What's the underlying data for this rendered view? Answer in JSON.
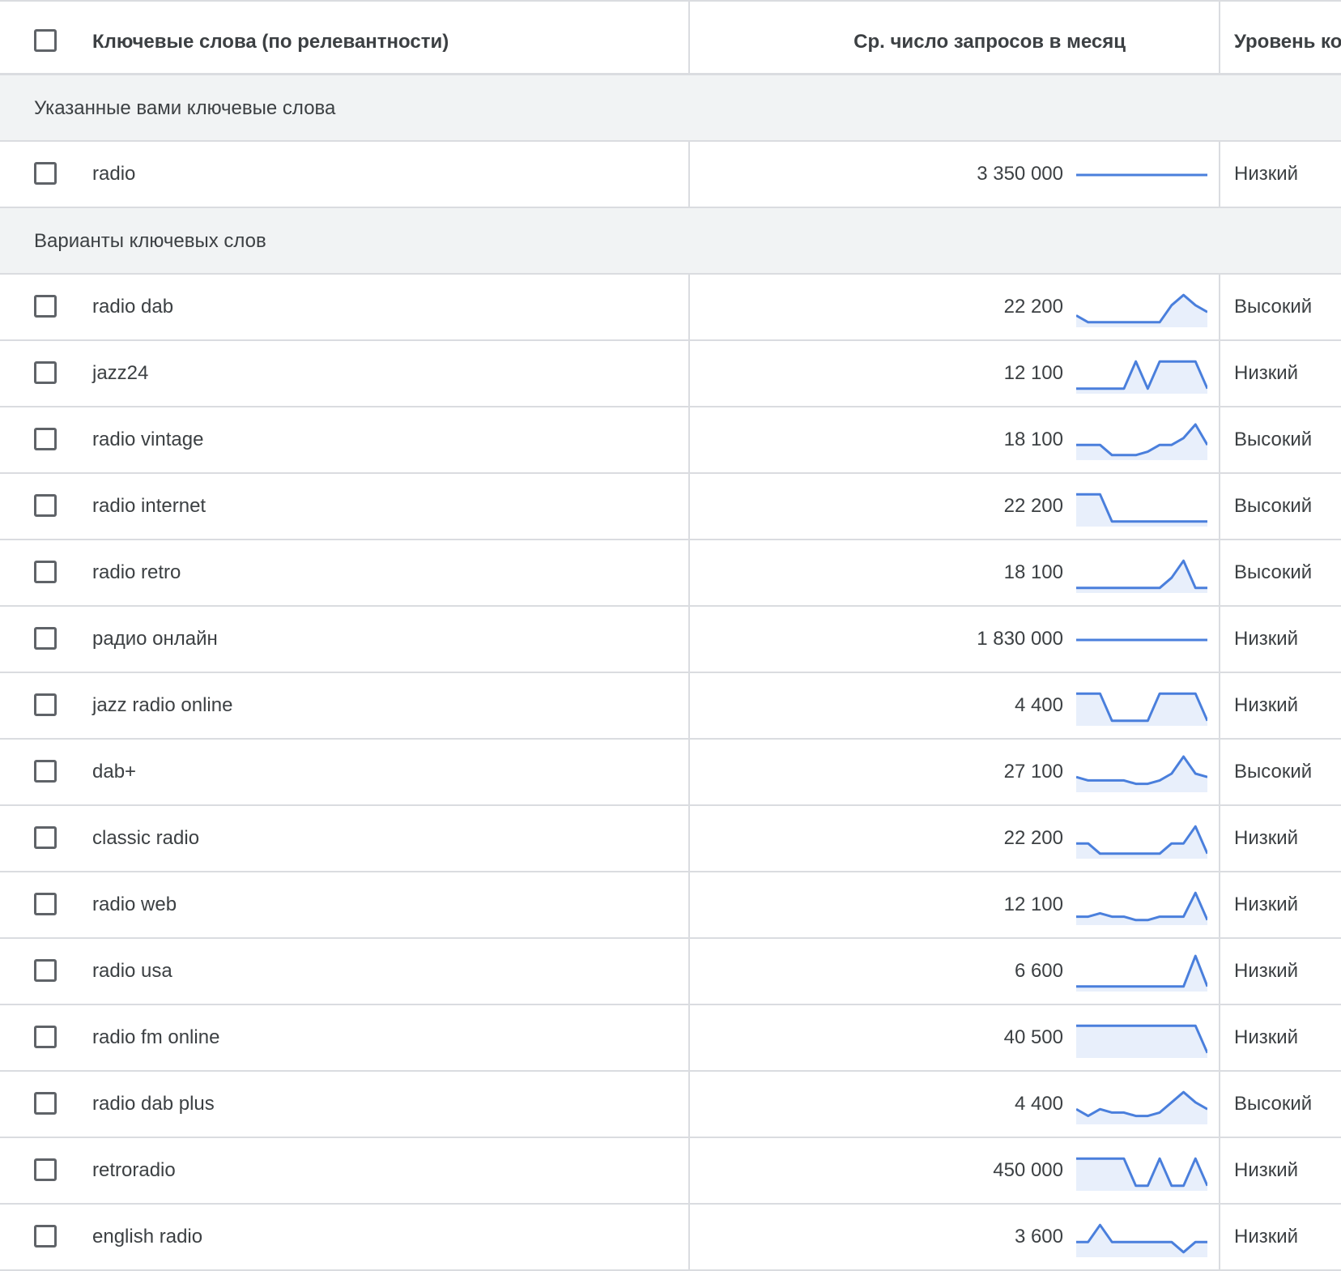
{
  "header": {
    "keywords_label": "Ключевые слова (по релевантности)",
    "volume_label": "Ср. число запросов в месяц",
    "competition_label": "Уровень конкуренции"
  },
  "groups": [
    {
      "label": "Указанные вами ключевые слова",
      "rows": [
        {
          "keyword": "radio",
          "volume": "3 350 000",
          "competition": "Низкий",
          "trend": [
            5,
            5,
            5,
            5,
            5,
            5,
            5,
            5,
            5,
            5,
            5,
            5
          ]
        }
      ]
    },
    {
      "label": "Варианты ключевых слов",
      "rows": [
        {
          "keyword": "radio dab",
          "volume": "22 200",
          "competition": "Высокий",
          "trend": [
            3,
            1,
            1,
            1,
            1,
            1,
            1,
            1,
            6,
            9,
            6,
            4
          ]
        },
        {
          "keyword": "jazz24",
          "volume": "12 100",
          "competition": "Низкий",
          "trend": [
            1,
            1,
            1,
            1,
            1,
            9,
            1,
            9,
            9,
            9,
            9,
            1
          ]
        },
        {
          "keyword": "radio vintage",
          "volume": "18 100",
          "competition": "Высокий",
          "trend": [
            4,
            4,
            4,
            1,
            1,
            1,
            2,
            4,
            4,
            6,
            10,
            4
          ]
        },
        {
          "keyword": "radio internet",
          "volume": "22 200",
          "competition": "Высокий",
          "trend": [
            9,
            9,
            9,
            1,
            1,
            1,
            1,
            1,
            1,
            1,
            1,
            1
          ]
        },
        {
          "keyword": "radio retro",
          "volume": "18 100",
          "competition": "Высокий",
          "trend": [
            1,
            1,
            1,
            1,
            1,
            1,
            1,
            1,
            4,
            9,
            1,
            1
          ]
        },
        {
          "keyword": "радио онлайн",
          "volume": "1 830 000",
          "competition": "Низкий",
          "trend": [
            5,
            5,
            5,
            5,
            5,
            5,
            5,
            5,
            5,
            5,
            5,
            5
          ]
        },
        {
          "keyword": "jazz radio online",
          "volume": "4 400",
          "competition": "Низкий",
          "trend": [
            9,
            9,
            9,
            1,
            1,
            1,
            1,
            9,
            9,
            9,
            9,
            1
          ]
        },
        {
          "keyword": "dab+",
          "volume": "27 100",
          "competition": "Высокий",
          "trend": [
            4,
            3,
            3,
            3,
            3,
            2,
            2,
            3,
            5,
            10,
            5,
            4
          ]
        },
        {
          "keyword": "classic radio",
          "volume": "22 200",
          "competition": "Низкий",
          "trend": [
            4,
            4,
            1,
            1,
            1,
            1,
            1,
            1,
            4,
            4,
            9,
            1
          ]
        },
        {
          "keyword": "radio web",
          "volume": "12 100",
          "competition": "Низкий",
          "trend": [
            2,
            2,
            3,
            2,
            2,
            1,
            1,
            2,
            2,
            2,
            9,
            1
          ]
        },
        {
          "keyword": "radio usa",
          "volume": "6 600",
          "competition": "Низкий",
          "trend": [
            1,
            1,
            1,
            1,
            1,
            1,
            1,
            1,
            1,
            1,
            10,
            1
          ]
        },
        {
          "keyword": "radio fm online",
          "volume": "40 500",
          "competition": "Низкий",
          "trend": [
            9,
            9,
            9,
            9,
            9,
            9,
            9,
            9,
            9,
            9,
            9,
            1
          ]
        },
        {
          "keyword": "radio dab plus",
          "volume": "4 400",
          "competition": "Высокий",
          "trend": [
            4,
            2,
            4,
            3,
            3,
            2,
            2,
            3,
            6,
            9,
            6,
            4
          ]
        },
        {
          "keyword": "retroradio",
          "volume": "450 000",
          "competition": "Низкий",
          "trend": [
            9,
            9,
            9,
            9,
            9,
            1,
            1,
            9,
            1,
            1,
            9,
            1
          ]
        },
        {
          "keyword": "english radio",
          "volume": "3 600",
          "competition": "Низкий",
          "trend": [
            4,
            4,
            9,
            4,
            4,
            4,
            4,
            4,
            4,
            1,
            4,
            4
          ]
        }
      ]
    }
  ],
  "colors": {
    "sparkline": "#4a7fdc",
    "sparkline_fill": "#e8effb",
    "group_bg": "#f1f3f4",
    "border": "#dadce0"
  }
}
